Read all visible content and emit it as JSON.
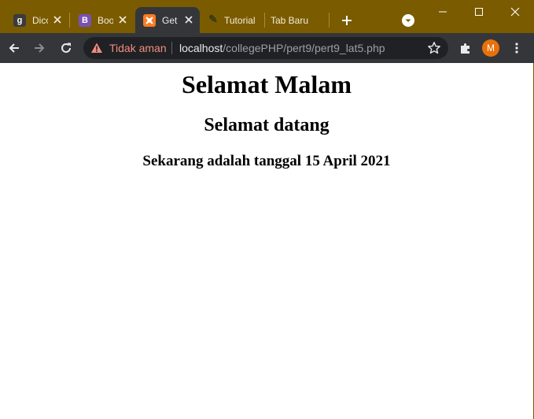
{
  "tabs": [
    {
      "title": "Dicoding",
      "favicon_letter": "g",
      "favicon_color": "#3b3b3b",
      "active": false
    },
    {
      "title": "Bootstrap",
      "favicon_letter": "B",
      "favicon_color": "#7952b3",
      "active": false
    },
    {
      "title": "Get",
      "favicon_letter": "",
      "favicon_color": "#fb7a24",
      "active": true
    },
    {
      "title": "Tutorial",
      "favicon_letter": "",
      "favicon_color": "#4d4d00",
      "active": false
    },
    {
      "title": "Tab Baru",
      "favicon_letter": "",
      "favicon_color": "",
      "active": false
    }
  ],
  "toolbar": {
    "security_label": "Tidak aman",
    "url_host": "localhost",
    "url_path": "/collegePHP/pert9/pert9_lat5.php",
    "profile_initial": "M",
    "profile_color": "#e8710a"
  },
  "page": {
    "greeting": "Selamat Malam",
    "welcome": "Selamat datang",
    "date_line": "Sekarang adalah tanggal 15 April 2021"
  }
}
